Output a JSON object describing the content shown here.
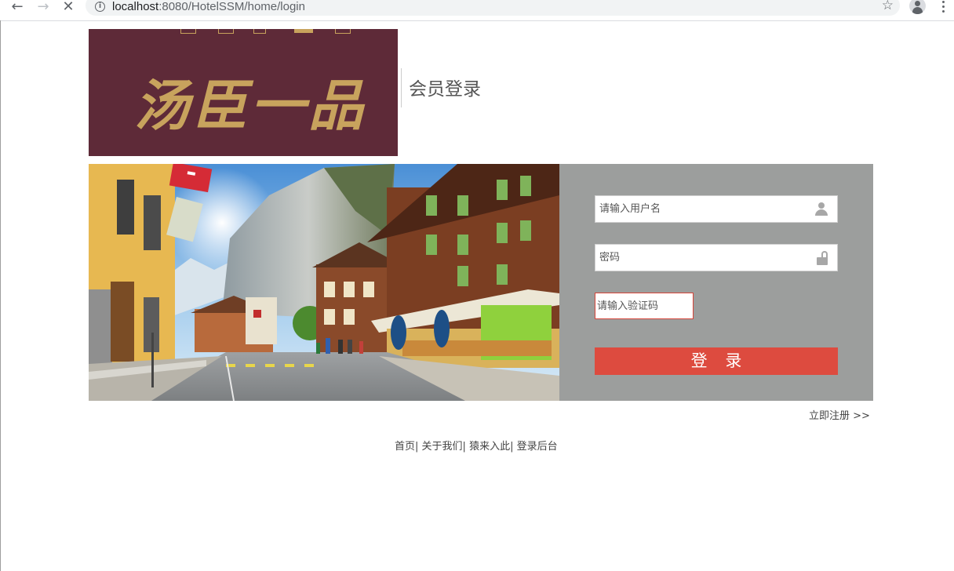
{
  "browser": {
    "url_host": "localhost",
    "url_rest": ":8080/HotelSSM/home/login"
  },
  "header": {
    "logo_text": "汤臣一品",
    "title": "会员登录"
  },
  "login": {
    "username_placeholder": "请输入用户名",
    "password_placeholder": "密码",
    "captcha_placeholder": "请输入验证码",
    "submit_label": "登 录"
  },
  "register_label": "立即注册 >>",
  "footer": {
    "links": [
      {
        "label": "首页"
      },
      {
        "label": "关于我们"
      },
      {
        "label": "猿来入此"
      },
      {
        "label": "登录后台"
      }
    ]
  },
  "colors": {
    "logo_bg": "#5e2a38",
    "logo_gold": "#c8a35d",
    "panel_bg": "#9c9e9d",
    "button_bg": "#dd4b3f"
  },
  "icons": [
    "back-icon",
    "forward-icon",
    "stop-icon",
    "info-icon",
    "star-icon",
    "profile-icon",
    "menu-icon",
    "user-icon",
    "lock-icon"
  ]
}
